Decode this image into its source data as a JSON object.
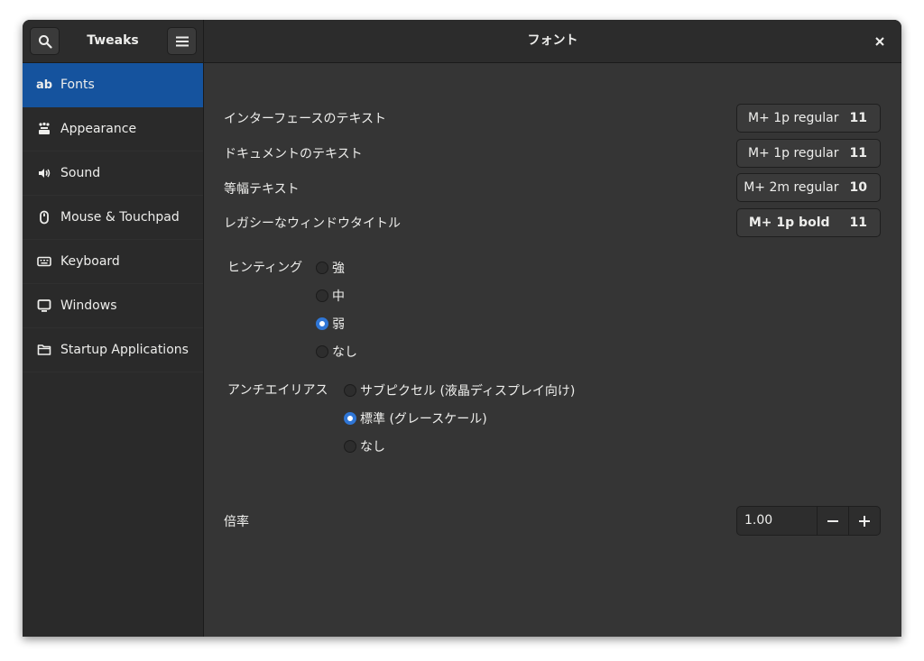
{
  "header": {
    "app_title": "Tweaks",
    "page_title": "フォント"
  },
  "sidebar": {
    "items": [
      {
        "label": "Fonts",
        "icon": "ab"
      },
      {
        "label": "Appearance"
      },
      {
        "label": "Sound"
      },
      {
        "label": "Mouse & Touchpad"
      },
      {
        "label": "Keyboard"
      },
      {
        "label": "Windows"
      },
      {
        "label": "Startup Applications"
      }
    ]
  },
  "fonts": {
    "interface": {
      "label": "インターフェースのテキスト",
      "name": "M+ 1p regular",
      "size": "11"
    },
    "document": {
      "label": "ドキュメントのテキスト",
      "name": "M+ 1p regular",
      "size": "11"
    },
    "monospace": {
      "label": "等幅テキスト",
      "name": "M+ 2m regular",
      "size": "10"
    },
    "titlebar": {
      "label": "レガシーなウィンドウタイトル",
      "name": "M+ 1p bold",
      "size": "11"
    }
  },
  "hinting": {
    "label": "ヒンティング",
    "options": [
      "強",
      "中",
      "弱",
      "なし"
    ],
    "selected": "弱"
  },
  "antialiasing": {
    "label": "アンチエイリアス",
    "options": [
      "サブピクセル (液晶ディスプレイ向け)",
      "標準 (グレースケール)",
      "なし"
    ],
    "selected": "標準 (グレースケール)"
  },
  "scaling": {
    "label": "倍率",
    "value": "1.00"
  },
  "colors": {
    "accent": "#15539e",
    "radio_selected": "#2f76d6",
    "background": "#353535"
  }
}
